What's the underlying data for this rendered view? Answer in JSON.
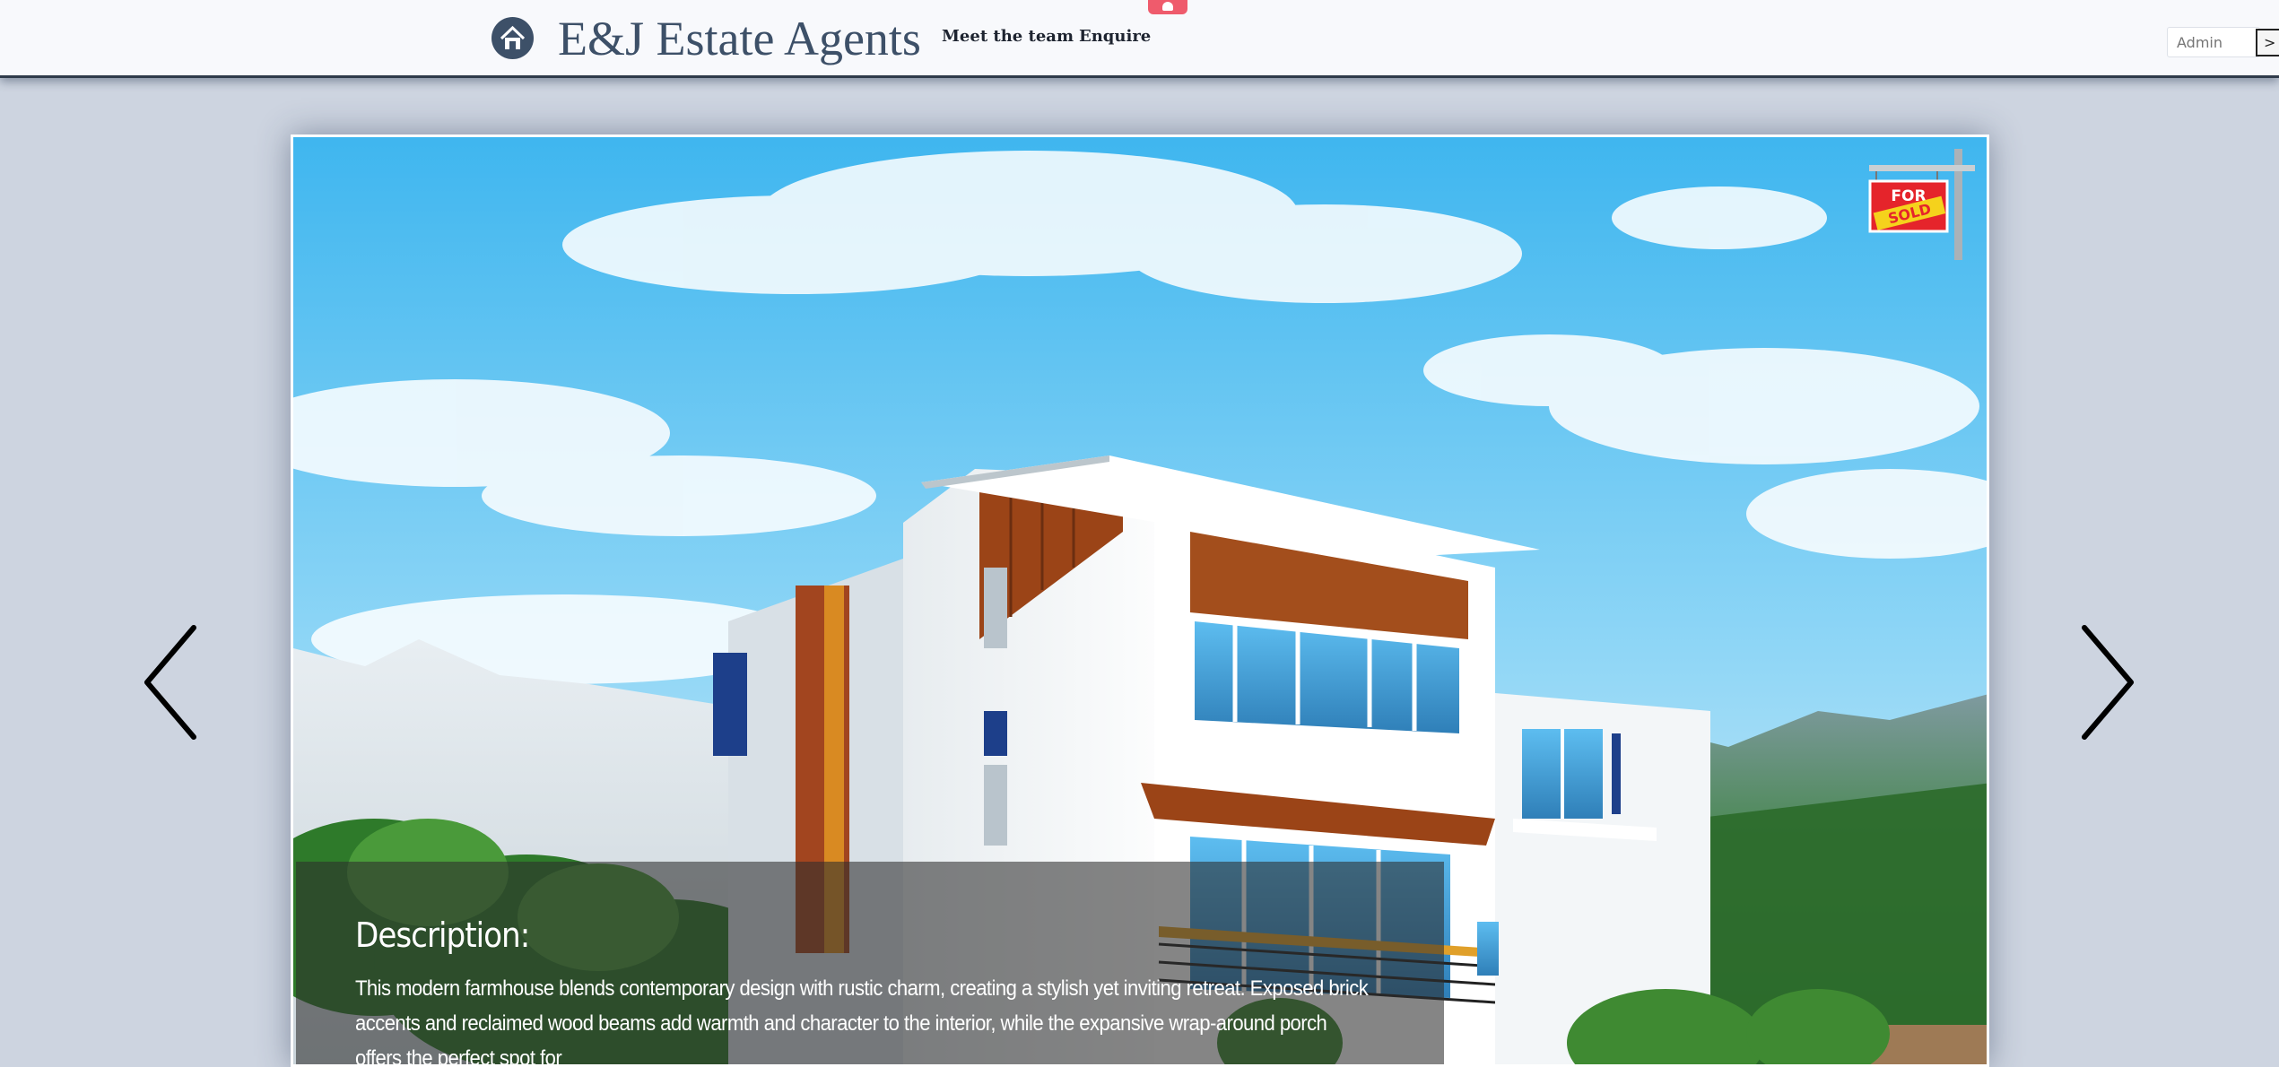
{
  "header": {
    "brand": "E&J Estate Agents",
    "logo_icon": "house-icon",
    "nav": [
      {
        "label": "Meet the team"
      },
      {
        "label": "Enquire"
      }
    ],
    "admin": {
      "placeholder": "Admin",
      "value": "",
      "submit_label": ">"
    }
  },
  "slider": {
    "prev_icon": "chevron-left-icon",
    "next_icon": "chevron-right-icon",
    "status_sign_icon": "for-sale-sold-sign-icon",
    "description": {
      "title": "Description:",
      "text": "This modern farmhouse blends contemporary design with rustic charm, creating a stylish yet inviting retreat. Exposed brick accents and reclaimed wood beams add warmth and character to the interior, while the expansive wrap-around porch offers the perfect spot for"
    }
  },
  "colors": {
    "page_background": "#cdd4e0",
    "header_background": "#f8f9fc",
    "brand_color": "#3d5068",
    "top_tab_accent": "#ef5b6c",
    "sign_red": "#e5242b",
    "sign_yellow": "#f5d21c"
  }
}
